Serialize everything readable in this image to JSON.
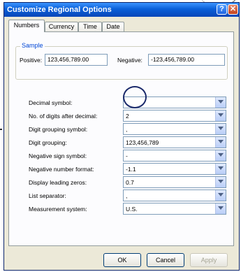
{
  "window": {
    "title": "Customize Regional Options",
    "help_symbol": "?",
    "close_symbol": "✕"
  },
  "tabs": [
    {
      "label": "Numbers",
      "active": true
    },
    {
      "label": "Currency"
    },
    {
      "label": "Time"
    },
    {
      "label": "Date"
    }
  ],
  "sample": {
    "legend": "Sample",
    "positive_label": "Positive:",
    "positive_value": "123,456,789.00",
    "negative_label": "Negative:",
    "negative_value": "-123,456,789.00"
  },
  "settings": [
    {
      "label": "Decimal symbol:",
      "value": "."
    },
    {
      "label": "No. of digits after decimal:",
      "value": "2"
    },
    {
      "label": "Digit grouping symbol:",
      "value": ","
    },
    {
      "label": "Digit grouping:",
      "value": "123,456,789"
    },
    {
      "label": "Negative sign symbol:",
      "value": "-"
    },
    {
      "label": "Negative number format:",
      "value": "-1.1"
    },
    {
      "label": "Display leading zeros:",
      "value": "0.7"
    },
    {
      "label": "List separator:",
      "value": ","
    },
    {
      "label": "Measurement system:",
      "value": "U.S."
    }
  ],
  "buttons": {
    "ok": "OK",
    "cancel": "Cancel",
    "apply": "Apply"
  },
  "colors": {
    "title_bar": "#0a5fd8",
    "group_legend": "#0046d5",
    "highlight_circle": "#1b2a6b"
  }
}
